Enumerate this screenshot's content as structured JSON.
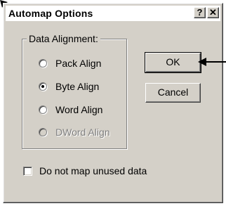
{
  "window": {
    "title": "Automap Options",
    "help_label": "?",
    "close_label": "✕"
  },
  "group": {
    "label": "Data Alignment:",
    "options": [
      {
        "label": "Pack Align",
        "checked": false,
        "disabled": false
      },
      {
        "label": "Byte Align",
        "checked": true,
        "disabled": false
      },
      {
        "label": "Word Align",
        "checked": false,
        "disabled": false
      },
      {
        "label": "DWord Align",
        "checked": false,
        "disabled": true
      }
    ]
  },
  "buttons": {
    "ok_label": "OK",
    "cancel_label": "Cancel"
  },
  "checkbox": {
    "label": "Do not map unused data",
    "checked": false
  },
  "colors": {
    "dialog_face": "#d4d0c8",
    "titlebar": "#ffffff",
    "disabled_text": "#808080"
  }
}
